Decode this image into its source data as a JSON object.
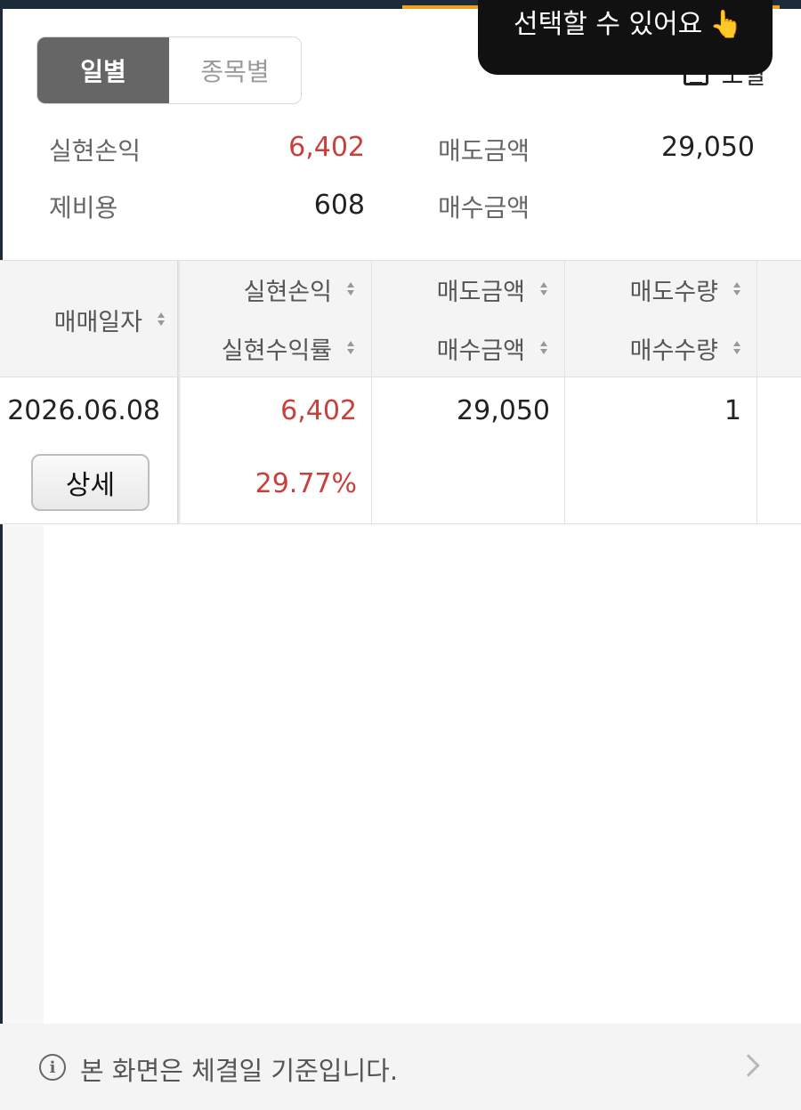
{
  "tabs": [
    {
      "label": "일별",
      "active": true
    },
    {
      "label": "종목별",
      "active": false
    }
  ],
  "tooltip": {
    "text": "선택할 수 있어요",
    "icon": "pointing-hand-icon"
  },
  "export": {
    "label": "エ일",
    "icon": "calendar-icon"
  },
  "summary": {
    "realized_pl_label": "실현손익",
    "realized_pl_value": "6,402",
    "sell_amount_label": "매도금액",
    "sell_amount_value": "29,050",
    "fees_label": "제비용",
    "fees_value": "608",
    "buy_amount_label": "매수금액",
    "buy_amount_value": ""
  },
  "table": {
    "headers": {
      "date": "매매일자",
      "realized_pl": "실현손익",
      "realized_rate": "실현수익률",
      "sell_amount": "매도금액",
      "buy_amount": "매수금액",
      "sell_qty": "매도수량",
      "buy_qty": "매수수량"
    },
    "rows": [
      {
        "date": "2026.06.08",
        "detail_label": "상세",
        "realized_pl": "6,402",
        "realized_rate": "29.77%",
        "sell_amount": "29,050",
        "buy_amount": "",
        "sell_qty": "1",
        "buy_qty": ""
      }
    ]
  },
  "footer": {
    "text": "본 화면은 체결일 기준입니다.",
    "icon": "info-icon"
  },
  "colors": {
    "profit": "#c8403c",
    "active_tab": "#666666",
    "header_bg": "#f4f4f4"
  }
}
